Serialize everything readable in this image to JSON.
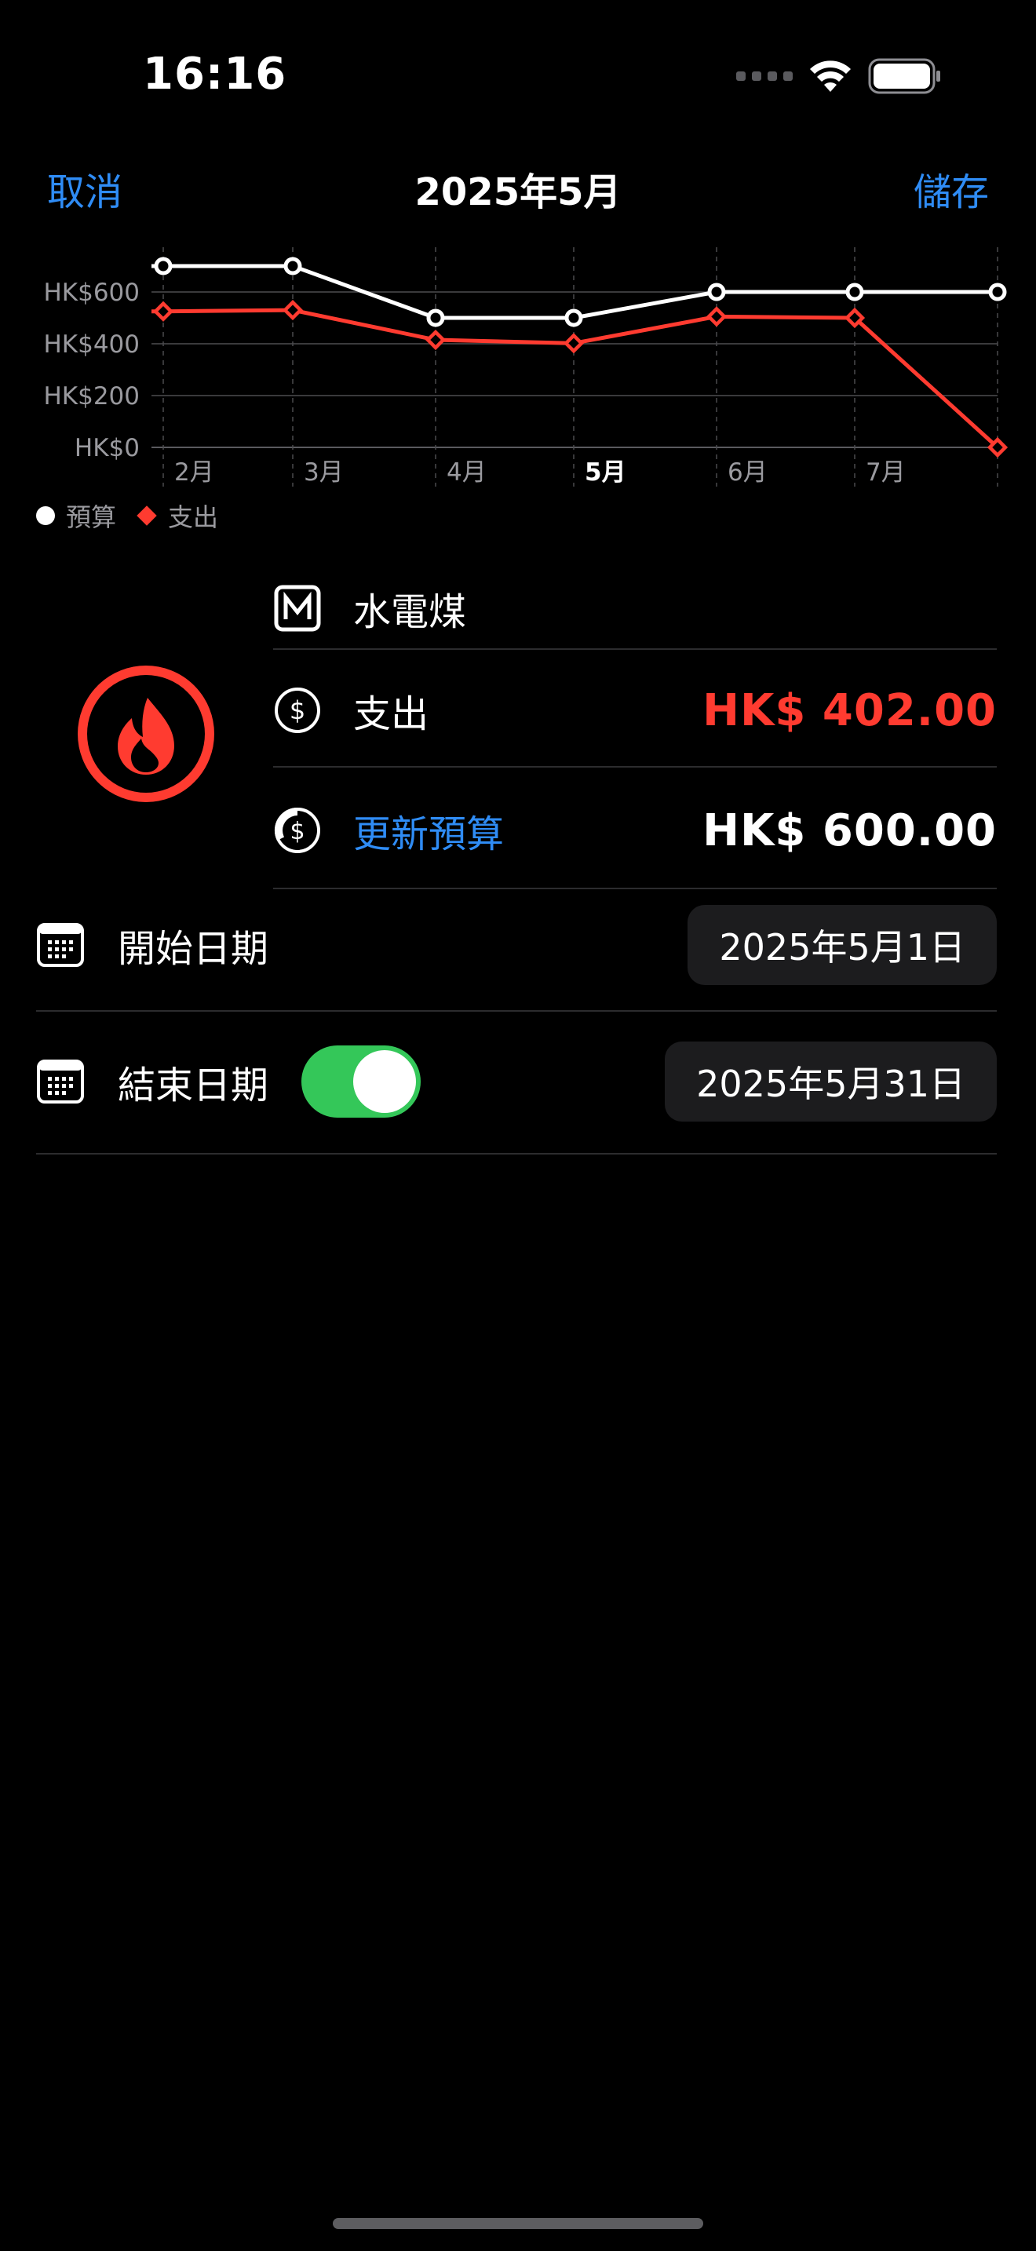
{
  "status_bar": {
    "time": "16:16"
  },
  "nav": {
    "cancel_label": "取消",
    "title": "2025年5月",
    "save_label": "儲存"
  },
  "chart_data": {
    "type": "line",
    "categories": [
      "",
      "2月",
      "3月",
      "4月",
      "5月",
      "6月",
      "7月",
      ""
    ],
    "highlighted_category": "5月",
    "y_ticks": [
      "HK$0",
      "HK$200",
      "HK$400",
      "HK$600"
    ],
    "ylim": [
      0,
      700
    ],
    "grid": true,
    "legend_position": "bottom-left",
    "series": [
      {
        "name": "預算",
        "color": "#ffffff",
        "marker": "circle",
        "values": [
          700,
          700,
          700,
          500,
          500,
          600,
          600,
          600
        ]
      },
      {
        "name": "支出",
        "color": "#ff3b30",
        "marker": "diamond",
        "values": [
          525,
          525,
          530,
          415,
          402,
          505,
          500,
          0
        ]
      }
    ]
  },
  "category": {
    "name": "水電煤",
    "icon": "flame-icon",
    "color": "#ff3b30"
  },
  "expense": {
    "label": "支出",
    "value": "HK$ 402.00",
    "color": "#ff3b30"
  },
  "budget": {
    "label": "更新預算",
    "value": "HK$ 600.00"
  },
  "start_date": {
    "label": "開始日期",
    "value": "2025年5月1日"
  },
  "end_date": {
    "label": "結束日期",
    "value": "2025年5月31日",
    "enabled": true
  }
}
